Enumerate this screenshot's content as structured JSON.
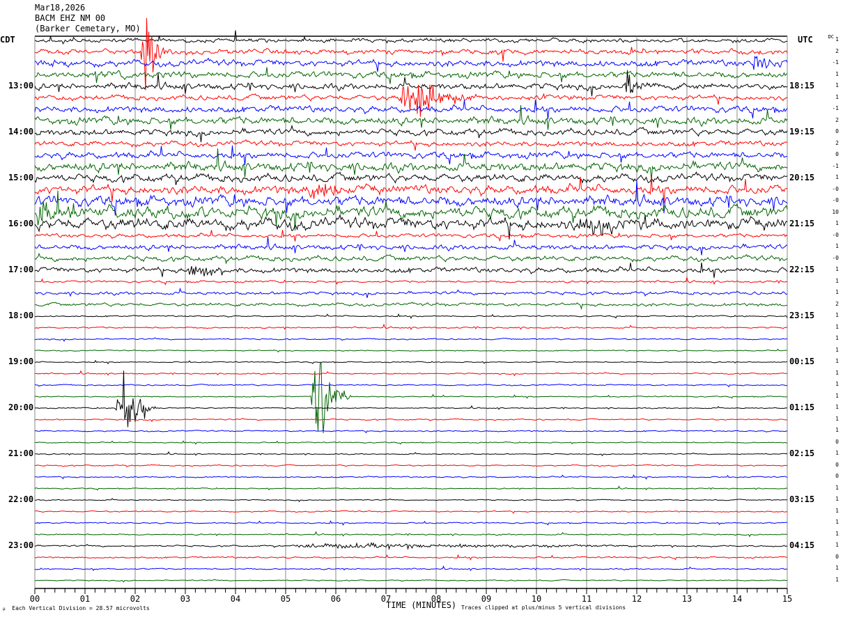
{
  "header": {
    "date": "Mar18,2026",
    "station": "BACM EHZ NM 00",
    "location": "(Barker Cemetary, MO)"
  },
  "left_axis_label": "CDT",
  "right_axis_label": "UTC",
  "dc_label": "DC",
  "footer": {
    "scale": "Each Vertical Division =   28.57 microvolts",
    "xlabel": "TIME (MINUTES)",
    "clip_note": "Traces clipped at plus/minus 5 vertical divisions"
  },
  "chart_data": {
    "type": "line",
    "title": "",
    "xlabel": "TIME (MINUTES)",
    "xlim": [
      0,
      15
    ],
    "x_ticks": [
      "00",
      "01",
      "02",
      "03",
      "04",
      "05",
      "06",
      "07",
      "08",
      "09",
      "10",
      "11",
      "12",
      "13",
      "14",
      "15"
    ],
    "trace_colors": [
      "#000000",
      "#ff0000",
      "#0000ff",
      "#006400"
    ],
    "grid": true,
    "left_labels": [
      {
        "trace": 4,
        "label": "13:00"
      },
      {
        "trace": 8,
        "label": "14:00"
      },
      {
        "trace": 12,
        "label": "15:00"
      },
      {
        "trace": 16,
        "label": "16:00"
      },
      {
        "trace": 20,
        "label": "17:00"
      },
      {
        "trace": 24,
        "label": "18:00"
      },
      {
        "trace": 28,
        "label": "19:00"
      },
      {
        "trace": 32,
        "label": "20:00"
      },
      {
        "trace": 36,
        "label": "21:00"
      },
      {
        "trace": 40,
        "label": "22:00"
      },
      {
        "trace": 44,
        "label": "23:00"
      }
    ],
    "right_labels": [
      {
        "trace": 4,
        "label": "18:15"
      },
      {
        "trace": 8,
        "label": "19:15"
      },
      {
        "trace": 12,
        "label": "20:15"
      },
      {
        "trace": 16,
        "label": "21:15"
      },
      {
        "trace": 20,
        "label": "22:15"
      },
      {
        "trace": 24,
        "label": "23:15"
      },
      {
        "trace": 28,
        "label": "00:15"
      },
      {
        "trace": 32,
        "label": "01:15"
      },
      {
        "trace": 36,
        "label": "02:15"
      },
      {
        "trace": 40,
        "label": "03:15"
      },
      {
        "trace": 44,
        "label": "04:15"
      }
    ],
    "dc_offsets": [
      "1",
      "2",
      "-1",
      "1",
      "1",
      "1",
      "-1",
      "2",
      "0",
      "2",
      "0",
      "-1",
      "1",
      "-0",
      "-0",
      "10",
      "1",
      "-0",
      "1",
      "-0",
      "1",
      "1",
      "1",
      "2",
      "1",
      "1",
      "1",
      "1",
      "1",
      "1",
      "1",
      "1",
      "1",
      "1",
      "1",
      "0",
      "1",
      "0",
      "0",
      "1",
      "1",
      "1",
      "1",
      "1",
      "1",
      "0",
      "1",
      "1"
    ],
    "noise_divisions": [
      0.15,
      0.2,
      0.25,
      0.25,
      0.25,
      0.2,
      0.25,
      0.3,
      0.25,
      0.2,
      0.25,
      0.35,
      0.3,
      0.35,
      0.4,
      0.45,
      0.45,
      0.15,
      0.2,
      0.2,
      0.2,
      0.08,
      0.12,
      0.12,
      0.05,
      0.06,
      0.05,
      0.04,
      0.04,
      0.05,
      0.05,
      0.04,
      0.04,
      0.05,
      0.05,
      0.04,
      0.04,
      0.05,
      0.05,
      0.04,
      0.04,
      0.05,
      0.05,
      0.05,
      0.06,
      0.06,
      0.05,
      0.04
    ],
    "events": [
      {
        "trace": 1,
        "start_min": 2.1,
        "duration_min": 0.5,
        "amplitude_div": 5
      },
      {
        "trace": 2,
        "start_min": 14.3,
        "duration_min": 0.6,
        "amplitude_div": 1.2
      },
      {
        "trace": 4,
        "start_min": 11.7,
        "duration_min": 0.7,
        "amplitude_div": 1.2
      },
      {
        "trace": 5,
        "start_min": 7.2,
        "duration_min": 1.6,
        "amplitude_div": 2.5
      },
      {
        "trace": 13,
        "start_min": 5.4,
        "duration_min": 0.9,
        "amplitude_div": 1.5
      },
      {
        "trace": 15,
        "start_min": 0.0,
        "duration_min": 0.5,
        "amplitude_div": 2.0
      },
      {
        "trace": 16,
        "start_min": 10.8,
        "duration_min": 1.2,
        "amplitude_div": 1.2
      },
      {
        "trace": 20,
        "start_min": 3.0,
        "duration_min": 0.8,
        "amplitude_div": 1.0
      },
      {
        "trace": 31,
        "start_min": 5.5,
        "duration_min": 0.8,
        "amplitude_div": 5
      },
      {
        "trace": 32,
        "start_min": 1.6,
        "duration_min": 0.8,
        "amplitude_div": 5
      },
      {
        "trace": 44,
        "start_min": 5.0,
        "duration_min": 8.5,
        "amplitude_div": 0.3
      }
    ]
  }
}
